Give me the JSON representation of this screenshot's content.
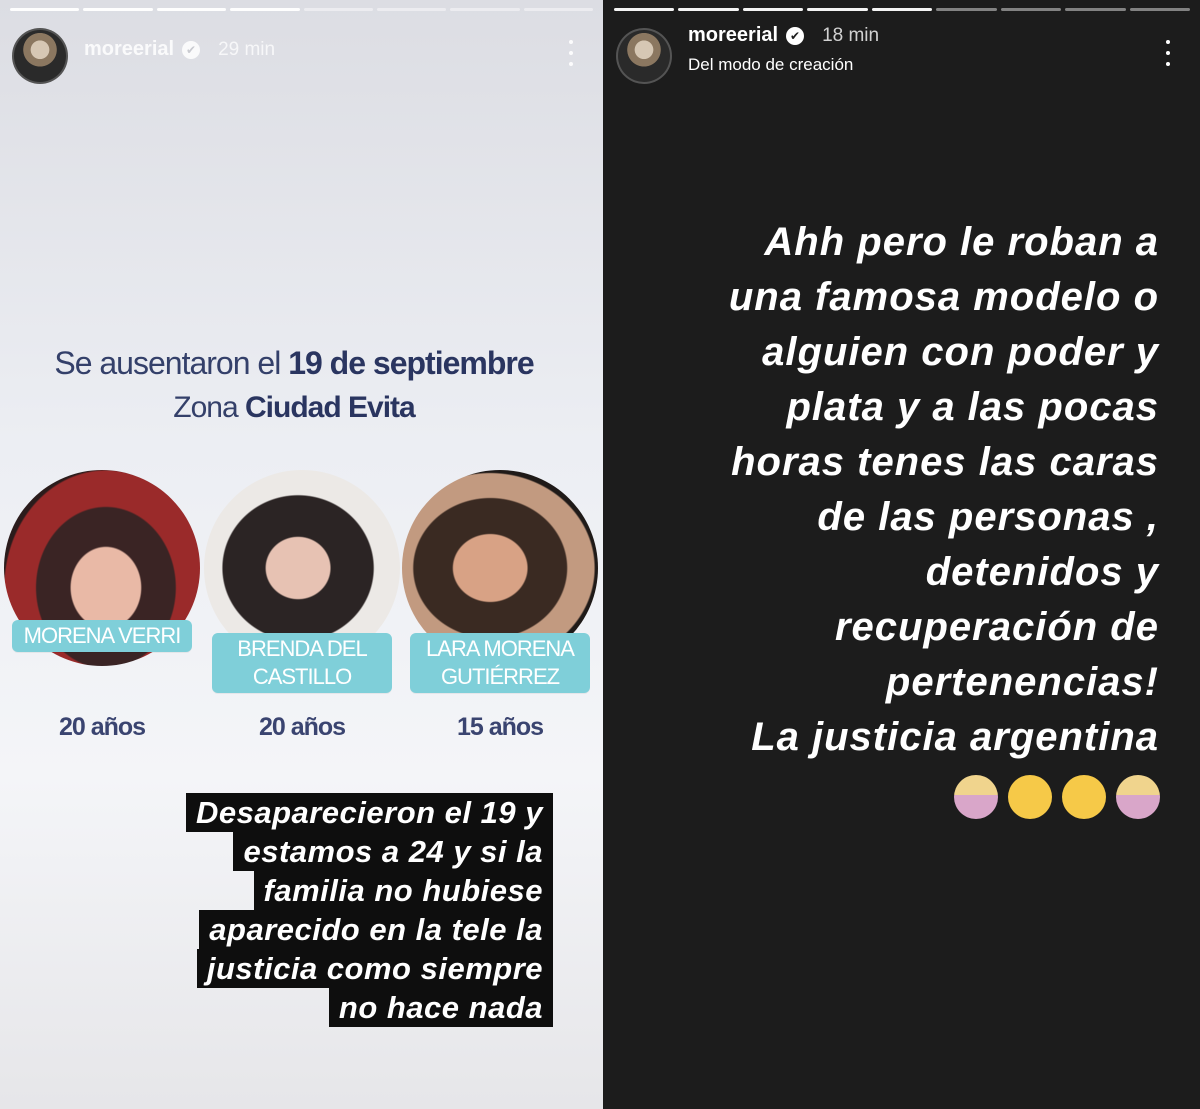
{
  "stories": [
    {
      "progress_total": 8,
      "progress_done": 4,
      "username": "moreerial",
      "verified_icon": "✔",
      "time": "29 min",
      "flyer": {
        "line1_prefix": "Se ausentaron el ",
        "line1_bold": "19 de septiembre",
        "line2_prefix": "Zona ",
        "line2_bold": "Ciudad Evita",
        "people": [
          {
            "name": "MORENA VERRI",
            "age": "20 años"
          },
          {
            "name": "BRENDA DEL CASTILLO",
            "age": "20 años"
          },
          {
            "name": "LARA MORENA GUTIÉRREZ",
            "age": "15 años"
          }
        ]
      },
      "caption_lines": [
        "Desaparecieron el 19 y",
        "estamos a 24 y si la",
        "familia no hubiese",
        "aparecido en la tele la",
        "justicia como siempre",
        "no hace nada"
      ]
    },
    {
      "progress_total": 9,
      "progress_done": 5,
      "username": "moreerial",
      "verified_icon": "✔",
      "time": "18 min",
      "subtitle": "Del modo de creación",
      "statement_lines": [
        "Ahh pero le roban a",
        "una famosa modelo o",
        "alguien con poder y",
        "plata y a las pocas",
        "horas tenes las caras",
        "de las personas ,",
        "detenidos y",
        "recuperación de",
        "pertenencias!",
        "La justicia argentina"
      ],
      "emojis": [
        {
          "name": "woman-facepalming-emoji",
          "glyph": "☹"
        },
        {
          "name": "zany-face-emoji",
          "glyph": "☺"
        },
        {
          "name": "woozy-face-emoji",
          "glyph": "☹"
        },
        {
          "name": "woman-shrugging-emoji",
          "glyph": "¯\\_(ツ)_/¯"
        }
      ]
    }
  ]
}
